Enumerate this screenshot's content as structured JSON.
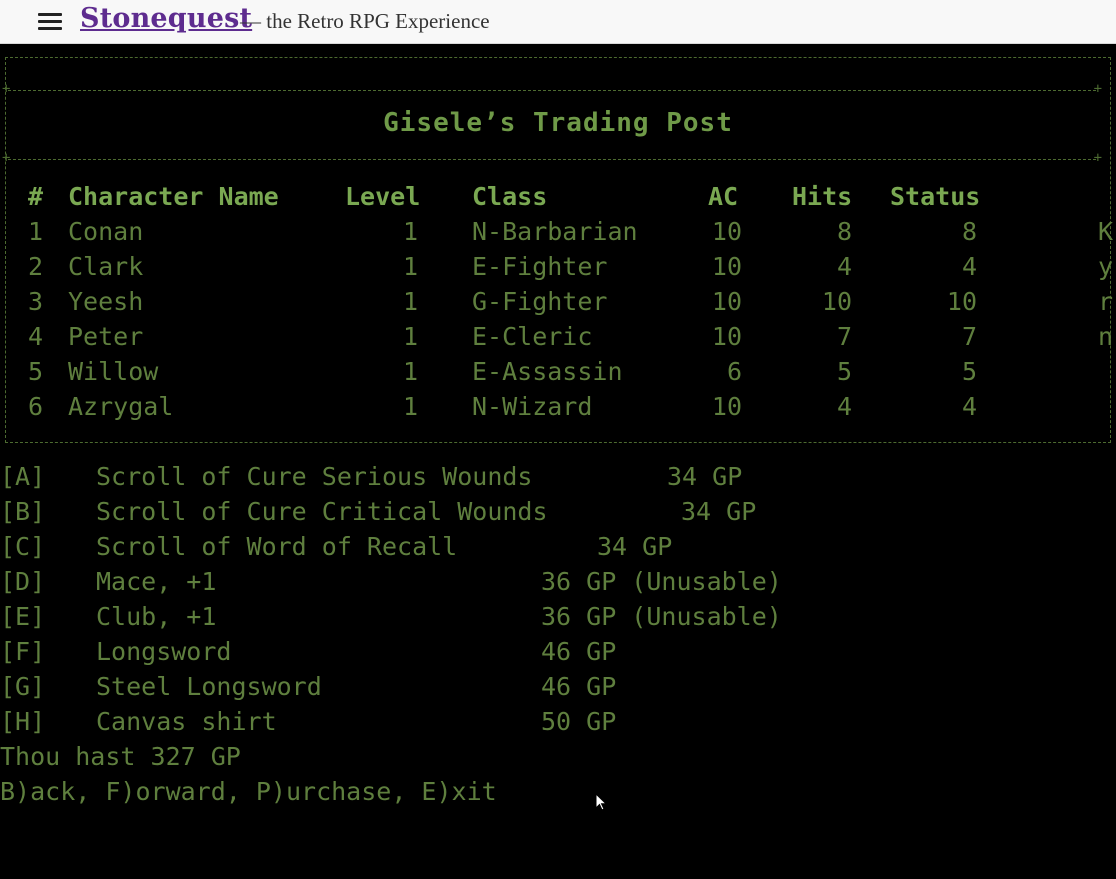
{
  "header": {
    "site_title": "Stonequest",
    "tagline": "— the Retro RPG Experience",
    "menu_icon": "hamburger-menu-icon"
  },
  "colors": {
    "screen_bg": "#000000",
    "text_green": "#5f7f3e",
    "header_green": "#7aa852",
    "title_purple": "#5e2c8f"
  },
  "shop": {
    "title": "Gisele’s Trading Post",
    "party_headers": [
      "#",
      "Character Name",
      "Level",
      "Class",
      "AC",
      "Hits",
      "Status"
    ],
    "party": [
      {
        "num": "1",
        "name": "Conan",
        "level": "1",
        "class": "N-Barbarian",
        "ac": "10",
        "hits": "8",
        "status": "8",
        "extra": "K"
      },
      {
        "num": "2",
        "name": "Clark",
        "level": "1",
        "class": "E-Fighter",
        "ac": "10",
        "hits": "4",
        "status": "4",
        "extra": "y"
      },
      {
        "num": "3",
        "name": "Yeesh",
        "level": "1",
        "class": "G-Fighter",
        "ac": "10",
        "hits": "10",
        "status": "10",
        "extra": "r"
      },
      {
        "num": "4",
        "name": "Peter",
        "level": "1",
        "class": "E-Cleric",
        "ac": "10",
        "hits": "7",
        "status": "7",
        "extra": "n"
      },
      {
        "num": "5",
        "name": "Willow",
        "level": "1",
        "class": "E-Assassin",
        "ac": "6",
        "hits": "5",
        "status": "5",
        "extra": ""
      },
      {
        "num": "6",
        "name": "Azrygal",
        "level": "1",
        "class": "N-Wizard",
        "ac": "10",
        "hits": "4",
        "status": "4",
        "extra": ""
      }
    ],
    "items": [
      {
        "key": "[A]",
        "name": "Scroll of Cure Serious Wounds",
        "price": "34 GP"
      },
      {
        "key": "[B]",
        "name": "Scroll of Cure Critical Wounds",
        "price": "34 GP"
      },
      {
        "key": "[C]",
        "name": "Scroll of Word of Recall",
        "price": "34 GP"
      },
      {
        "key": "[D]",
        "name": "Mace, +1",
        "price": "36 GP (Unusable)"
      },
      {
        "key": "[E]",
        "name": "Club, +1",
        "price": "36 GP (Unusable)"
      },
      {
        "key": "[F]",
        "name": "Longsword",
        "price": "46 GP"
      },
      {
        "key": "[G]",
        "name": "Steel Longsword",
        "price": "46 GP"
      },
      {
        "key": "[H]",
        "name": "Canvas shirt",
        "price": "50 GP"
      }
    ],
    "gold": "Thou hast 327 GP",
    "commands": "B)ack, F)orward, P)urchase, E)xit"
  }
}
